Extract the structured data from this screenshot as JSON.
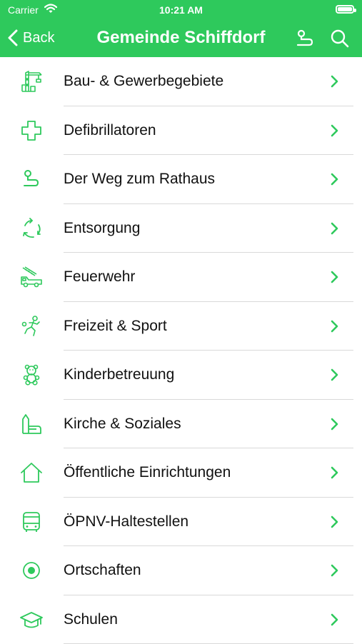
{
  "status_bar": {
    "carrier": "Carrier",
    "time": "10:21 AM"
  },
  "nav": {
    "back_label": "Back",
    "title": "Gemeinde Schiffdorf"
  },
  "colors": {
    "accent": "#2ec95c",
    "text": "#111111",
    "divider": "#d9d9d9"
  },
  "items": [
    {
      "label": "Bau- & Gewerbegebiete",
      "icon": "crane-icon"
    },
    {
      "label": "Defibrillatoren",
      "icon": "medical-cross-icon"
    },
    {
      "label": "Der Weg zum Rathaus",
      "icon": "route-icon"
    },
    {
      "label": "Entsorgung",
      "icon": "recycle-icon"
    },
    {
      "label": "Feuerwehr",
      "icon": "fire-truck-icon"
    },
    {
      "label": "Freizeit & Sport",
      "icon": "soccer-player-icon"
    },
    {
      "label": "Kinderbetreuung",
      "icon": "teddy-bear-icon"
    },
    {
      "label": "Kirche & Soziales",
      "icon": "church-icon"
    },
    {
      "label": "Öffentliche Einrichtungen",
      "icon": "house-icon"
    },
    {
      "label": "ÖPNV-Haltestellen",
      "icon": "bus-icon"
    },
    {
      "label": "Ortschaften",
      "icon": "location-dot-icon"
    },
    {
      "label": "Schulen",
      "icon": "graduation-cap-icon"
    }
  ]
}
